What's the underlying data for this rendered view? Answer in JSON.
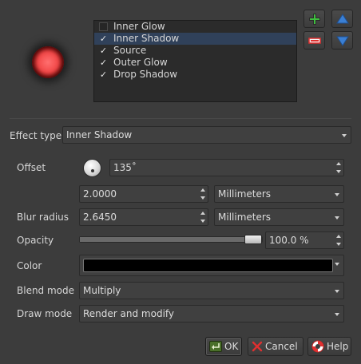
{
  "effects": [
    {
      "label": "Inner Glow",
      "checked": false,
      "selected": false
    },
    {
      "label": "Inner Shadow",
      "checked": true,
      "selected": true
    },
    {
      "label": "Source",
      "checked": true,
      "selected": false
    },
    {
      "label": "Outer Glow",
      "checked": true,
      "selected": false
    },
    {
      "label": "Drop Shadow",
      "checked": true,
      "selected": false
    }
  ],
  "check_mark": "✓",
  "side_buttons": {
    "add": {
      "icon": "plus-icon",
      "color": "#3fbf3f"
    },
    "remove": {
      "icon": "minus-icon",
      "color": "#e03030"
    },
    "up": {
      "icon": "arrow-up-icon",
      "color": "#3a7fd4"
    },
    "down": {
      "icon": "arrow-down-icon",
      "color": "#3a7fd4"
    }
  },
  "effect_type": {
    "label": "Effect type",
    "value": "Inner Shadow"
  },
  "offset": {
    "label": "Offset",
    "angle": "135˚",
    "distance": "2.0000",
    "unit": "Millimeters"
  },
  "blur_radius": {
    "label": "Blur radius",
    "value": "2.6450",
    "unit": "Millimeters"
  },
  "opacity": {
    "label": "Opacity",
    "value": "100.0 %",
    "level": 1.0
  },
  "color": {
    "label": "Color",
    "value": "#000000"
  },
  "blend_mode": {
    "label": "Blend mode",
    "value": "Multiply"
  },
  "draw_mode": {
    "label": "Draw mode",
    "value": "Render and modify"
  },
  "buttons": {
    "ok": "OK",
    "cancel": "Cancel",
    "help": "Help"
  }
}
